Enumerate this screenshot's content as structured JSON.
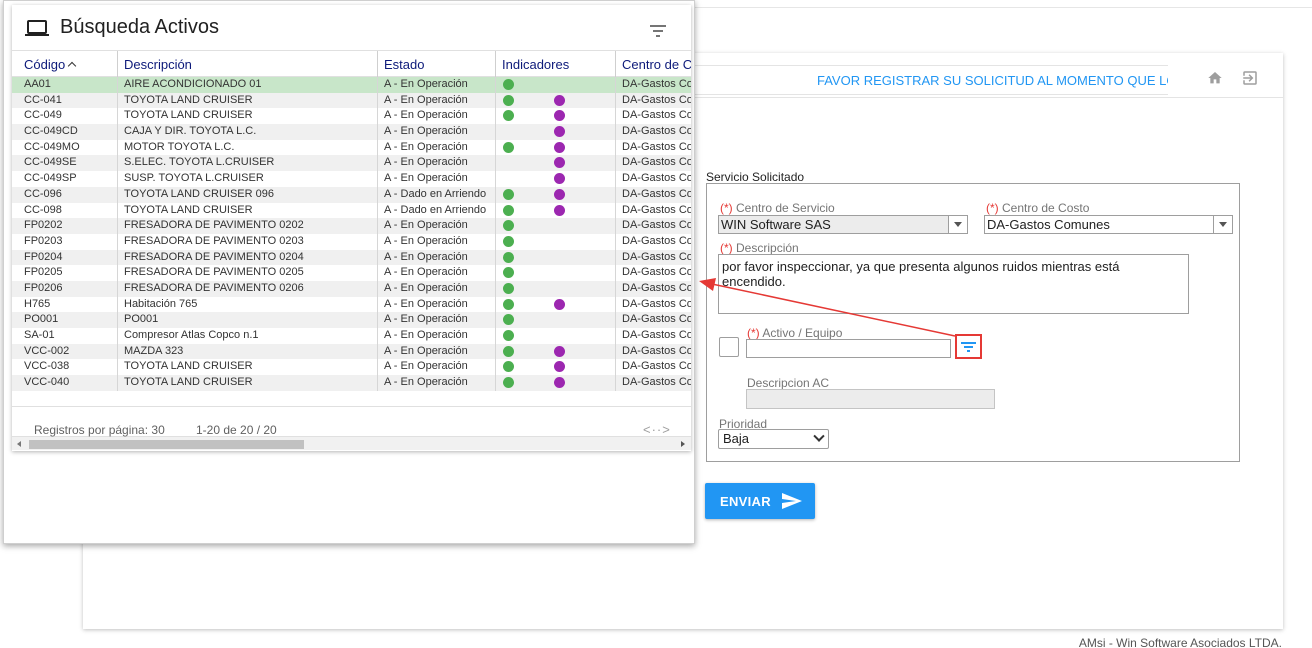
{
  "background_form": {
    "notice": "FAVOR REGISTRAR SU SOLICITUD AL MOMENTO QUE LO",
    "section_title": "Servicio Solicitado",
    "required_mark": "(*)",
    "service_center": {
      "label": "Centro de Servicio",
      "value": "WIN Software SAS"
    },
    "cost_center": {
      "label": "Centro de Costo",
      "value": "DA-Gastos Comunes"
    },
    "description": {
      "label": "Descripción",
      "value": "por favor inspeccionar, ya que presenta algunos ruidos mientras está encendido."
    },
    "asset": {
      "label": "Activo / Equipo",
      "value": ""
    },
    "asset_description": {
      "label": "Descripcion AC",
      "value": ""
    },
    "priority": {
      "label": "Prioridad",
      "value": "Baja"
    },
    "submit_label": "ENVIAR"
  },
  "footer": "AMsi - Win Software Asociados LTDA.",
  "modal": {
    "title": "Búsqueda Activos",
    "columns": [
      "Código",
      "Descripción",
      "Estado",
      "Indicadores",
      "Centro de C"
    ],
    "rows": [
      {
        "code": "AA01",
        "desc": "AIRE ACONDICIONADO 01",
        "state": "A - En Operación",
        "green": true,
        "purple": false,
        "cc": "DA-Gastos Co"
      },
      {
        "code": "CC-041",
        "desc": "TOYOTA LAND CRUISER",
        "state": "A - En Operación",
        "green": true,
        "purple": true,
        "cc": "DA-Gastos Co"
      },
      {
        "code": "CC-049",
        "desc": "TOYOTA LAND CRUISER",
        "state": "A - En Operación",
        "green": true,
        "purple": true,
        "cc": "DA-Gastos Co"
      },
      {
        "code": "CC-049CD",
        "desc": "CAJA Y DIR. TOYOTA L.C.",
        "state": "A - En Operación",
        "green": false,
        "purple": true,
        "cc": "DA-Gastos Co"
      },
      {
        "code": "CC-049MO",
        "desc": "MOTOR TOYOTA L.C.",
        "state": "A - En Operación",
        "green": true,
        "purple": true,
        "cc": "DA-Gastos Co"
      },
      {
        "code": "CC-049SE",
        "desc": "S.ELEC. TOYOTA L.CRUISER",
        "state": "A - En Operación",
        "green": false,
        "purple": true,
        "cc": "DA-Gastos Co"
      },
      {
        "code": "CC-049SP",
        "desc": "SUSP. TOYOTA L.CRUISER",
        "state": "A - En Operación",
        "green": false,
        "purple": true,
        "cc": "DA-Gastos Co"
      },
      {
        "code": "CC-096",
        "desc": "TOYOTA LAND CRUISER 096",
        "state": "A - Dado en Arriendo",
        "green": true,
        "purple": true,
        "cc": "DA-Gastos Co"
      },
      {
        "code": "CC-098",
        "desc": "TOYOTA LAND CRUISER",
        "state": "A - Dado en Arriendo",
        "green": true,
        "purple": true,
        "cc": "DA-Gastos Co"
      },
      {
        "code": "FP0202",
        "desc": "FRESADORA DE PAVIMENTO 0202",
        "state": "A - En Operación",
        "green": true,
        "purple": false,
        "cc": "DA-Gastos Co"
      },
      {
        "code": "FP0203",
        "desc": "FRESADORA DE PAVIMENTO 0203",
        "state": "A - En Operación",
        "green": true,
        "purple": false,
        "cc": "DA-Gastos Co"
      },
      {
        "code": "FP0204",
        "desc": "FRESADORA DE PAVIMENTO 0204",
        "state": "A - En Operación",
        "green": true,
        "purple": false,
        "cc": "DA-Gastos Co"
      },
      {
        "code": "FP0205",
        "desc": "FRESADORA DE PAVIMENTO 0205",
        "state": "A - En Operación",
        "green": true,
        "purple": false,
        "cc": "DA-Gastos Co"
      },
      {
        "code": "FP0206",
        "desc": "FRESADORA DE PAVIMENTO 0206",
        "state": "A - En Operación",
        "green": true,
        "purple": false,
        "cc": "DA-Gastos Co"
      },
      {
        "code": "H765",
        "desc": "Habitación 765",
        "state": "A - En Operación",
        "green": true,
        "purple": true,
        "cc": "DA-Gastos Co"
      },
      {
        "code": "PO001",
        "desc": "PO001",
        "state": "A - En Operación",
        "green": true,
        "purple": false,
        "cc": "DA-Gastos Co"
      },
      {
        "code": "SA-01",
        "desc": "Compresor Atlas Copco n.1",
        "state": "A - En Operación",
        "green": true,
        "purple": false,
        "cc": "DA-Gastos Co"
      },
      {
        "code": "VCC-002",
        "desc": "MAZDA 323",
        "state": "A - En Operación",
        "green": true,
        "purple": true,
        "cc": "DA-Gastos Co"
      },
      {
        "code": "VCC-038",
        "desc": "TOYOTA LAND CRUISER",
        "state": "A - En Operación",
        "green": true,
        "purple": true,
        "cc": "DA-Gastos Co"
      },
      {
        "code": "VCC-040",
        "desc": "TOYOTA LAND CRUISER",
        "state": "A - En Operación",
        "green": true,
        "purple": true,
        "cc": "DA-Gastos Co"
      }
    ],
    "rows_per_page_label": "Registros por página: 30",
    "range_label": "1-20 de 20 / 20",
    "nav_label": "<··>"
  },
  "colors": {
    "accent_blue": "#2196f3",
    "selected_row": "#c8e6c9",
    "indicator_green": "#4caf50",
    "indicator_purple": "#9c27b0",
    "annotation_red": "#e53935"
  },
  "icons": [
    "laptop-icon",
    "filter-icon",
    "home-icon",
    "exit-icon",
    "send-icon"
  ]
}
